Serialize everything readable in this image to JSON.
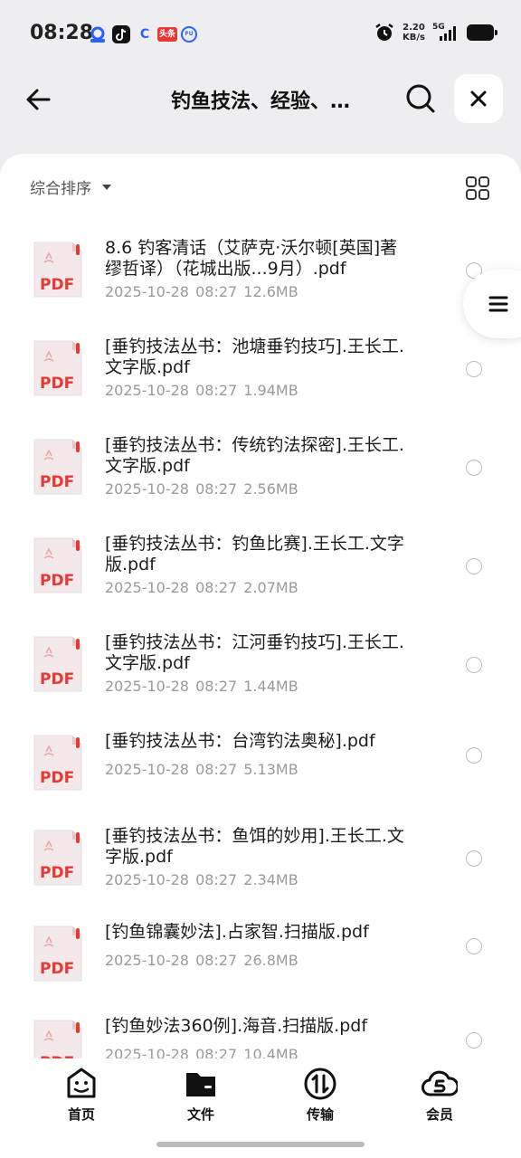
{
  "status_bar": {
    "time": "08:28",
    "net_speed": "2.20",
    "net_speed_unit": "KB/s",
    "network": "5G",
    "app_icons": [
      "cloud-app-icon",
      "tiktok-icon",
      "c-app-icon",
      "toutiao-icon",
      "fu-app-icon"
    ],
    "app_icon_colors": [
      "#2a62ff",
      "#111111",
      "#2a62ff",
      "#e53935",
      "#2a62ff"
    ],
    "toutiao_label": "头条",
    "fu_label": "FU",
    "c_label": "C"
  },
  "header": {
    "title": "钓鱼技法、经验、…",
    "back_icon": "arrow-left-icon",
    "search_icon": "search-icon",
    "close_icon": "close-icon"
  },
  "toolbar": {
    "sort_label": "综合排序",
    "view_icon": "grid-view-icon"
  },
  "file_icon_label": "PDF",
  "files": [
    {
      "name": "8.6 钓客清话（艾萨克·沃尔顿[英国]著 缪哲译）（花城出版...9月）.pdf",
      "date": "2025-10-28 08:27",
      "size": "12.6MB"
    },
    {
      "name": "[垂钓技法丛书：池塘垂钓技巧].王长工.文字版.pdf",
      "date": "2025-10-28 08:27",
      "size": "1.94MB"
    },
    {
      "name": "[垂钓技法丛书：传统钓法探密].王长工.文字版.pdf",
      "date": "2025-10-28 08:27",
      "size": "2.56MB"
    },
    {
      "name": "[垂钓技法丛书：钓鱼比赛].王长工.文字版.pdf",
      "date": "2025-10-28 08:27",
      "size": "2.07MB"
    },
    {
      "name": "[垂钓技法丛书：江河垂钓技巧].王长工.文字版.pdf",
      "date": "2025-10-28 08:27",
      "size": "1.44MB"
    },
    {
      "name": "[垂钓技法丛书：台湾钓法奥秘].pdf",
      "date": "2025-10-28 08:27",
      "size": "5.13MB"
    },
    {
      "name": "[垂钓技法丛书：鱼饵的妙用].王长工.文字版.pdf",
      "date": "2025-10-28 08:27",
      "size": "2.34MB"
    },
    {
      "name": "[钓鱼锦囊妙法].占家智.扫描版.pdf",
      "date": "2025-10-28 08:27",
      "size": "26.8MB"
    },
    {
      "name": "[钓鱼妙法360例].海音.扫描版.pdf",
      "date": "2025-10-28 08:27",
      "size": "10.4MB"
    }
  ],
  "side_tab_icon": "menu-icon",
  "bottom_nav": [
    {
      "label": "首页",
      "icon": "home-face-icon"
    },
    {
      "label": "文件",
      "icon": "folder-icon"
    },
    {
      "label": "传输",
      "icon": "transfer-icon"
    },
    {
      "label": "会员",
      "icon": "member-cloud-icon"
    }
  ]
}
